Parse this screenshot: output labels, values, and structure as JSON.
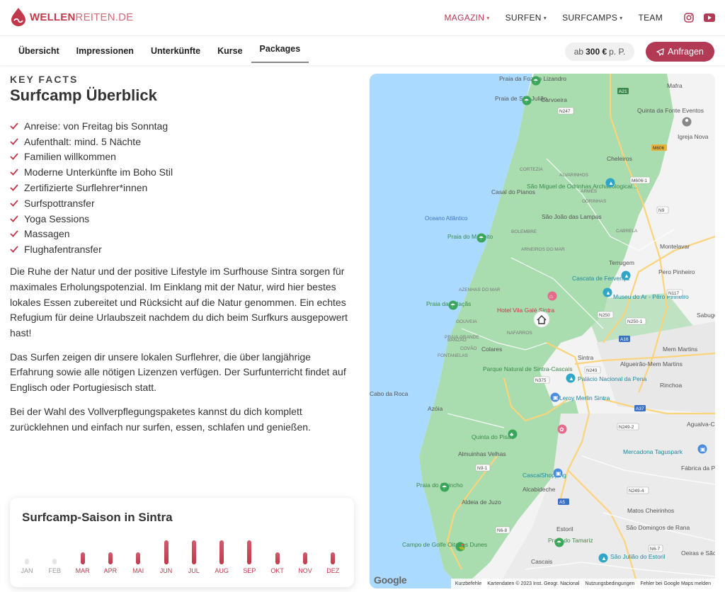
{
  "brand": {
    "bold": "WELLEN",
    "light": "REITEN.DE"
  },
  "nav": {
    "items": [
      {
        "label": "MAGAZIN",
        "dropdown": true,
        "active": true
      },
      {
        "label": "SURFEN",
        "dropdown": true,
        "active": false
      },
      {
        "label": "SURFCAMPS",
        "dropdown": true,
        "active": false
      },
      {
        "label": "TEAM",
        "dropdown": false,
        "active": false
      }
    ],
    "social_icons": [
      "instagram-icon",
      "youtube-icon"
    ]
  },
  "subnav": {
    "tabs": [
      "Übersicht",
      "Impressionen",
      "Unterkünfte",
      "Kurse",
      "Packages"
    ],
    "active_tab": "Packages",
    "price_prefix": "ab",
    "price_value": "300 €",
    "price_suffix": "p. P.",
    "cta_label": "Anfragen"
  },
  "content": {
    "eyebrow": "KEY FACTS",
    "title": "Surfcamp Überblick",
    "facts": [
      "Anreise: von Freitag bis Sonntag",
      "Aufenthalt: mind. 5 Nächte",
      "Familien willkommen",
      "Moderne Unterkünfte im Boho Stil",
      "Zertifizierte Surflehrer*innen",
      "Surfspottransfer",
      "Yoga Sessions",
      "Massagen",
      "Flughafentransfer"
    ],
    "paragraphs": [
      "Die Ruhe der Natur und der positive Lifestyle im Surfhouse Sintra sorgen für maximales Erholungspotenzial. Im Einklang mit der Natur, wird hier bestes lokales Essen zubereitet und Rücksicht auf die Natur genommen. Ein echtes Refugium für deine Urlaubszeit nachdem du dich beim Surfkurs ausgepowert hast!",
      "Das Surfen zeigen dir unsere lokalen Surflehrer, die über langjährige Erfahrung sowie alle nötigen Lizenzen verfügen. Der Surfunterricht findet auf Englisch oder Portugiesisch statt.",
      "Bei der Wahl des Vollverpflegungspaketes kannst du dich komplett zurücklehnen und einfach nur surfen, essen, schlafen und genießen."
    ]
  },
  "season": {
    "title": "Surfcamp-Saison in Sintra",
    "months": [
      "JAN",
      "FEB",
      "MAR",
      "APR",
      "MAI",
      "JUN",
      "JUL",
      "AUG",
      "SEP",
      "OKT",
      "NOV",
      "DEZ"
    ],
    "levels": [
      0.2,
      0.2,
      0.5,
      0.5,
      0.5,
      1.0,
      1.0,
      1.0,
      1.0,
      0.5,
      0.5,
      0.5
    ],
    "active_color": "#c0394b",
    "inactive_color": "#e6e6e6"
  },
  "map": {
    "labels": {
      "ocean": "Oceano Atlântico",
      "places": [
        "Praia da Foz do Lizandro",
        "Praia de São Julião",
        "Carvoeira",
        "Mafra",
        "Quinta da Fonte Eventos",
        "Igreja Nova",
        "Cheleiros",
        "Casal do Pianos",
        "São Miguel de Odrinhas Archaeological...",
        "São João das Lampas",
        "Praia do Magoito",
        "Montelavar",
        "Terrugem",
        "Pero Pinheiro",
        "Cascata de Fervença",
        "Museu do Ar - Pêro Pinheiro",
        "Praia das Maçãs",
        "Hotel Vila Galé Sintra",
        "Colares",
        "Sintra",
        "Parque Natural de Sintra-Cascais",
        "Palácio Nacional da Pena",
        "Mem Martins",
        "Algueirão-Mem Martins",
        "Rinchoa",
        "Leroy Merlin Sintra",
        "Azóia",
        "Quinta do Pisão",
        "Almuinhas Velhas",
        "CascaiShopping",
        "Mercadona Taguspark",
        "Praia do Guincho",
        "Alcabideche",
        "Aldeia de Juzo",
        "Matos Cheirinhos",
        "São Domingos de Rana",
        "Estoril",
        "Campo de Golfe Oitavos Dunes",
        "Praia do Tamariz",
        "Cascais",
        "São Julião do Estoril",
        "Oeiras e São Julião da Barra",
        "Fábrica da Pólvora de Barcarena",
        "Agualva-Cacém",
        "Sabugo",
        "Cabo da Roca"
      ],
      "small": [
        "CORTEZIA",
        "ALVARINHOS",
        "ARMÊS",
        "ODRINHAS",
        "BOLEMBRE",
        "ARNEIROS DO MAR",
        "AZENHAS DO MAR",
        "CABRELA",
        "PRAIA GRANDE",
        "NAFARROS",
        "BANZÃO",
        "COVÃO",
        "FONTANELAS",
        "GOUVEIA"
      ],
      "roads": [
        "A21",
        "N247",
        "M606",
        "M606-1",
        "N9",
        "N117",
        "N250",
        "N250-1",
        "A16",
        "N249",
        "N375",
        "A37",
        "N249-2",
        "N249-4",
        "N9-1",
        "A5",
        "N6-7",
        "N6-8"
      ]
    },
    "google": "Google",
    "attribution": [
      "Kurzbefehle",
      "Kartendaten © 2023 Inst. Geogr. Nacional",
      "Nutzungsbedingungen",
      "Fehler bei Google Maps melden"
    ]
  }
}
